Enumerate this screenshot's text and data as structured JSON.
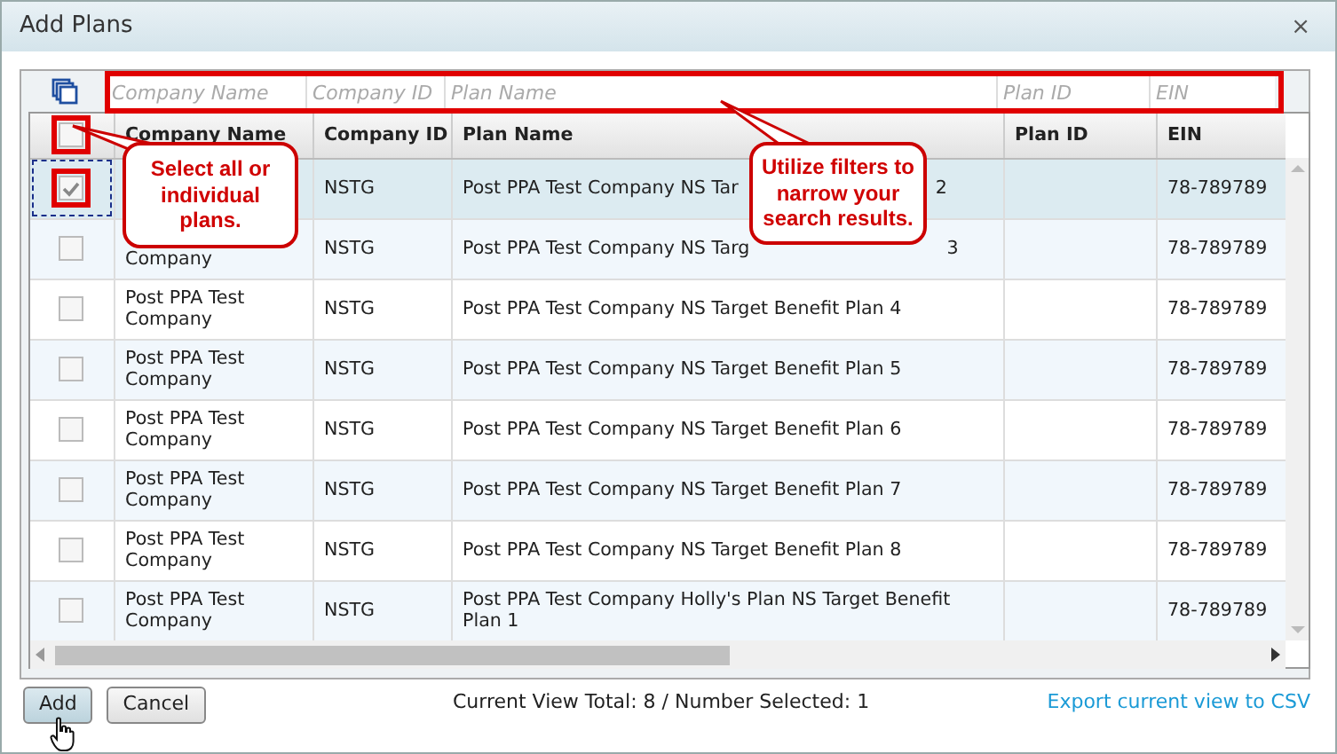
{
  "window": {
    "title": "Add Plans",
    "close": "×"
  },
  "filters": [
    {
      "placeholder": "Company Name"
    },
    {
      "placeholder": "Company ID"
    },
    {
      "placeholder": "Plan Name"
    },
    {
      "placeholder": "Plan ID"
    },
    {
      "placeholder": "EIN"
    }
  ],
  "filters_highlighted": true,
  "columns": [
    "Company Name",
    "Company ID",
    "Plan Name",
    "Plan ID",
    "EIN"
  ],
  "select_all": {
    "checked": false,
    "highlighted": true
  },
  "rows": [
    {
      "selected": true,
      "checked": true,
      "highlighted": true,
      "focused": true,
      "company_id": "NSTG",
      "plan_name_parts": [
        "Post PPA Test Company NS Tar",
        "2"
      ],
      "ein": "78-789789"
    },
    {
      "selected": false,
      "checked": false,
      "highlighted": false,
      "focused": false,
      "company_name": "Company",
      "company_name_partly_covered": true,
      "company_id": "NSTG",
      "plan_name_parts": [
        "Post PPA Test Company NS Targ",
        "3"
      ],
      "ein": "78-789789"
    },
    {
      "selected": false,
      "checked": false,
      "highlighted": false,
      "focused": false,
      "company_name": "Post PPA Test Company",
      "company_id": "NSTG",
      "plan_name": "Post PPA Test Company NS Target Benefit Plan 4",
      "ein": "78-789789"
    },
    {
      "selected": false,
      "checked": false,
      "highlighted": false,
      "focused": false,
      "company_name": "Post PPA Test Company",
      "company_id": "NSTG",
      "plan_name": "Post PPA Test Company NS Target Benefit Plan 5",
      "ein": "78-789789"
    },
    {
      "selected": false,
      "checked": false,
      "highlighted": false,
      "focused": false,
      "company_name": "Post PPA Test Company",
      "company_id": "NSTG",
      "plan_name": "Post PPA Test Company NS Target Benefit Plan 6",
      "ein": "78-789789"
    },
    {
      "selected": false,
      "checked": false,
      "highlighted": false,
      "focused": false,
      "company_name": "Post PPA Test Company",
      "company_id": "NSTG",
      "plan_name": "Post PPA Test Company NS Target Benefit Plan 7",
      "ein": "78-789789"
    },
    {
      "selected": false,
      "checked": false,
      "highlighted": false,
      "focused": false,
      "company_name": "Post PPA Test Company",
      "company_id": "NSTG",
      "plan_name": "Post PPA Test Company NS Target Benefit Plan 8",
      "ein": "78-789789"
    },
    {
      "selected": false,
      "checked": false,
      "highlighted": false,
      "focused": false,
      "company_name": "Post PPA Test Company",
      "company_id": "NSTG",
      "plan_name": "Post PPA Test Company Holly's Plan NS Target Benefit Plan 1",
      "ein": "78-789789"
    }
  ],
  "annotations": [
    {
      "text": "Select all or individual plans."
    },
    {
      "text": "Utilize filters to narrow your search results."
    }
  ],
  "buttons": [
    {
      "label": "Add",
      "hovered": true
    },
    {
      "label": "Cancel",
      "hovered": false
    }
  ],
  "status": "Current View Total: 8 / Number Selected: 1",
  "export_link": "Export current view to CSV"
}
